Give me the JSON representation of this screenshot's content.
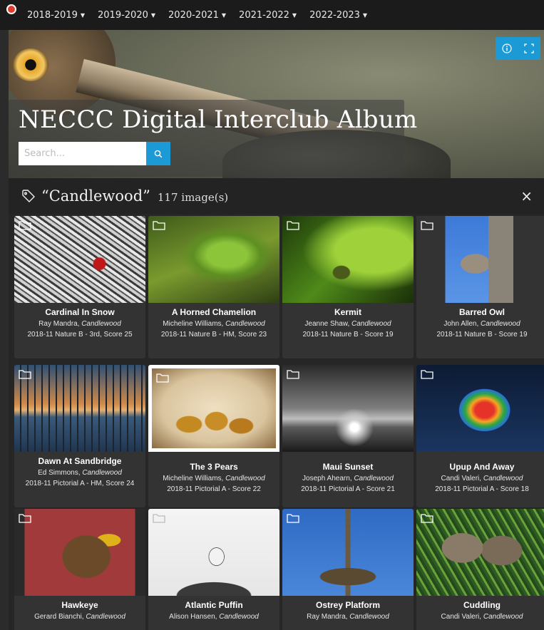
{
  "nav": {
    "logo_icon": "red-circle-logo",
    "years": [
      "2018-2019",
      "2019-2020",
      "2020-2021",
      "2021-2022",
      "2022-2023"
    ]
  },
  "hero": {
    "title": "NECCC Digital Interclub Album",
    "search_placeholder": "Search...",
    "search_icon": "search-icon",
    "info_icon": "info-icon",
    "fullscreen_icon": "fullscreen-icon",
    "accent_color": "#1b9ad6"
  },
  "tag": {
    "icon": "tag-icon",
    "name": "“Candlewood”",
    "count": "117 image(s)",
    "close_label": "×"
  },
  "cards": [
    {
      "title": "Cardinal In Snow",
      "author": "Ray Mandra,",
      "club": "Candlewood",
      "score": "2018-11 Nature B - 3rd, Score 25"
    },
    {
      "title": "A Horned Chamelion",
      "author": "Micheline Williams,",
      "club": "Candlewood",
      "score": "2018-11 Nature B - HM, Score 23"
    },
    {
      "title": "Kermit",
      "author": "Jeanne Shaw,",
      "club": "Candlewood",
      "score": "2018-11 Nature B - Score 19"
    },
    {
      "title": "Barred Owl",
      "author": "John Allen,",
      "club": "Candlewood",
      "score": "2018-11 Nature B - Score 19"
    },
    {
      "title": "Dawn At Sandbridge",
      "author": "Ed Simmons,",
      "club": "Candlewood",
      "score": "2018-11 Pictorial A - HM, Score 24"
    },
    {
      "title": "The 3 Pears",
      "author": "Micheline Williams,",
      "club": "Candlewood",
      "score": "2018-11 Pictorial A - Score 22"
    },
    {
      "title": "Maui Sunset",
      "author": "Joseph Ahearn,",
      "club": "Candlewood",
      "score": "2018-11 Pictorial A - Score 21"
    },
    {
      "title": "Upup And Away",
      "author": "Candi Valeri,",
      "club": "Candlewood",
      "score": "2018-11 Pictorial A - Score 18"
    },
    {
      "title": "Hawkeye",
      "author": "Gerard Bianchi,",
      "club": "Candlewood",
      "score": ""
    },
    {
      "title": "Atlantic Puffin",
      "author": "Alison Hansen,",
      "club": "Candlewood",
      "score": ""
    },
    {
      "title": "Ostrey Platform",
      "author": "Ray Mandra,",
      "club": "Candlewood",
      "score": ""
    },
    {
      "title": "Cuddling",
      "author": "Candi Valeri,",
      "club": "Candlewood",
      "score": ""
    }
  ]
}
